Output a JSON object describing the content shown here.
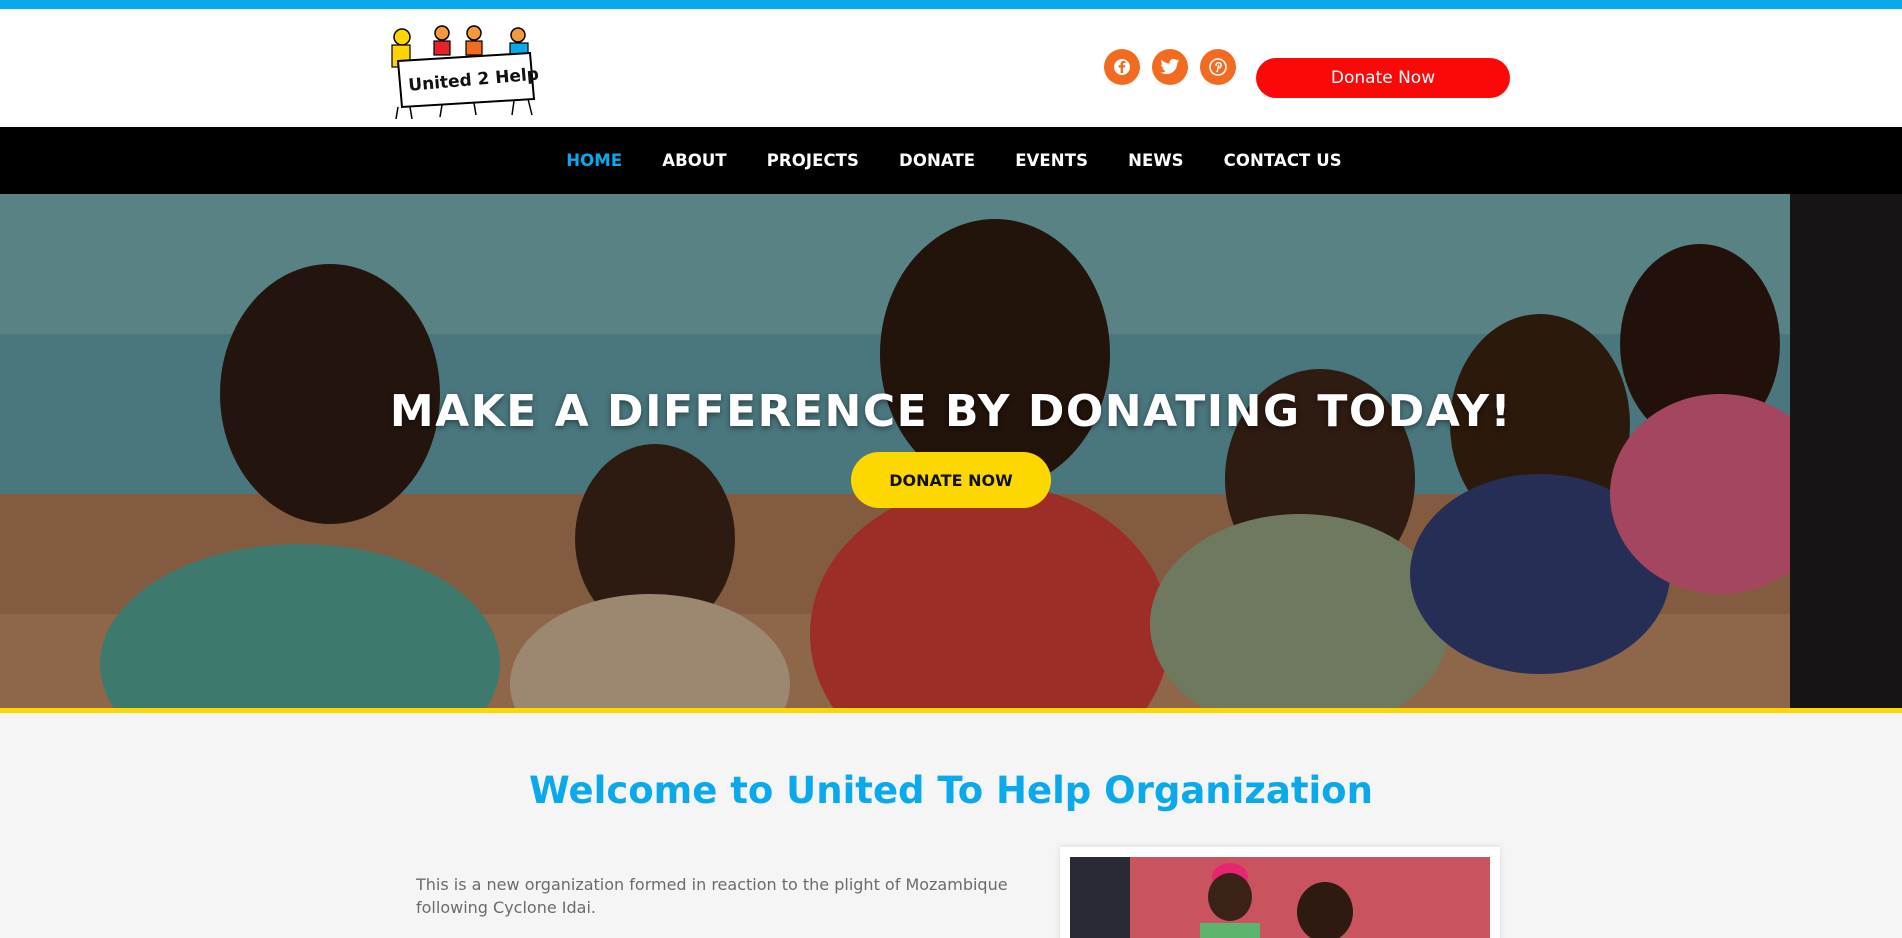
{
  "header": {
    "logo_text": "United 2 Help",
    "social": [
      {
        "name": "facebook-icon"
      },
      {
        "name": "twitter-icon"
      },
      {
        "name": "pinterest-icon"
      }
    ],
    "donate_label": "Donate Now"
  },
  "nav": {
    "items": [
      {
        "label": "HOME",
        "active": true
      },
      {
        "label": "ABOUT"
      },
      {
        "label": "PROJECTS"
      },
      {
        "label": "DONATE"
      },
      {
        "label": "EVENTS"
      },
      {
        "label": "NEWS"
      },
      {
        "label": "CONTACT US"
      }
    ]
  },
  "hero": {
    "title": "MAKE A DIFFERENCE BY DONATING TODAY!",
    "button_label": "DONATE NOW"
  },
  "welcome": {
    "title": "Welcome to United To Help Organization",
    "text": "This is a new organization formed in reaction to the plight of Mozambique following Cyclone Idai."
  },
  "colors": {
    "accent_blue": "#0aa9eb",
    "donate_red": "#fb0808",
    "hero_yellow": "#fdd800",
    "social_orange": "#f26b21"
  }
}
